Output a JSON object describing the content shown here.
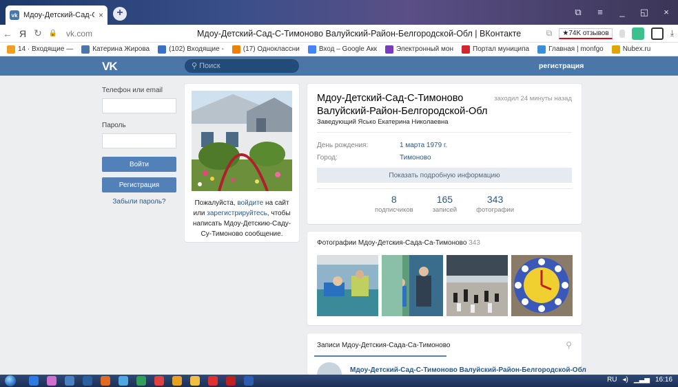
{
  "browser": {
    "tab_title": "Мдоу-Детский-Сад-С-Т",
    "tab_close": "×",
    "new_tab": "+",
    "window_controls": [
      "⧉",
      "≡",
      "_",
      "◱",
      "×"
    ],
    "url_display": "vk.com",
    "page_title": "Мдоу-Детский-Сад-С-Тимоново Валуйский-Район-Белгородской-Обл | ВКонтакте",
    "rating_label": "★74K отзывов",
    "nav": {
      "back": "←",
      "yandex": "Я",
      "reload": "↻",
      "lock": "🔒"
    }
  },
  "bookmarks": [
    {
      "label": "14 · Входящие — ",
      "color": "#f0a01e"
    },
    {
      "label": "Катерина Жирова",
      "color": "#4a76a8"
    },
    {
      "label": "(102) Входящие - ",
      "color": "#3c6fc6"
    },
    {
      "label": "(17) Одноклассни",
      "color": "#ee8208"
    },
    {
      "label": "Вход – Google Акк",
      "color": "#4285f4"
    },
    {
      "label": "Электронный мон",
      "color": "#7a3bbf"
    },
    {
      "label": "Портал муниципа",
      "color": "#d0282e"
    },
    {
      "label": "Главная | monfgo",
      "color": "#3a8fd8"
    },
    {
      "label": "Nubex.ru",
      "color": "#e2a400"
    }
  ],
  "vk": {
    "logo": "VK",
    "search_placeholder": "Поиск",
    "register_link": "регистрация"
  },
  "login": {
    "phone_label": "Телефон или email",
    "password_label": "Пароль",
    "login_button": "Войти",
    "register_button": "Регистрация",
    "forgot_link": "Забыли пароль?"
  },
  "avatar_card": {
    "msg_pre": "Пожалуйста, ",
    "msg_link1": "войдите",
    "msg_mid": " на сайт или ",
    "msg_link2": "зарегистрируйтесь",
    "msg_post": ", чтобы написать Мдоу-Детскию-Саду-Су-Тимоново сообщение."
  },
  "profile": {
    "name_line1": "Мдоу-Детский-Сад-С-Тимоново",
    "name_line2": "Валуйский-Район-Белгородской-Обл",
    "status": "Заведующий Ясько Екатерина Николаевна",
    "last_seen": "заходил 24 минуты назад",
    "birthday_label": "День рождения:",
    "birthday_value": "1 марта 1979 г.",
    "city_label": "Город:",
    "city_value": "Тимоново",
    "more_button": "Показать подробную информацию",
    "counters": [
      {
        "num": "8",
        "label": "подписчиков"
      },
      {
        "num": "165",
        "label": "записей"
      },
      {
        "num": "343",
        "label": "фотографии"
      }
    ]
  },
  "photos": {
    "header": "Фотографии Мдоу-Детския-Сада-Са-Тимоново",
    "count": "343"
  },
  "wall": {
    "header": "Записи Мдоу-Детския-Сада-Са-Тимоново",
    "post_author": "Мдоу-Детский-Сад-С-Тимоново Валуйский-Район-Белгородской-Обл"
  },
  "taskbar": {
    "lang": "RU",
    "time": "16:16"
  }
}
